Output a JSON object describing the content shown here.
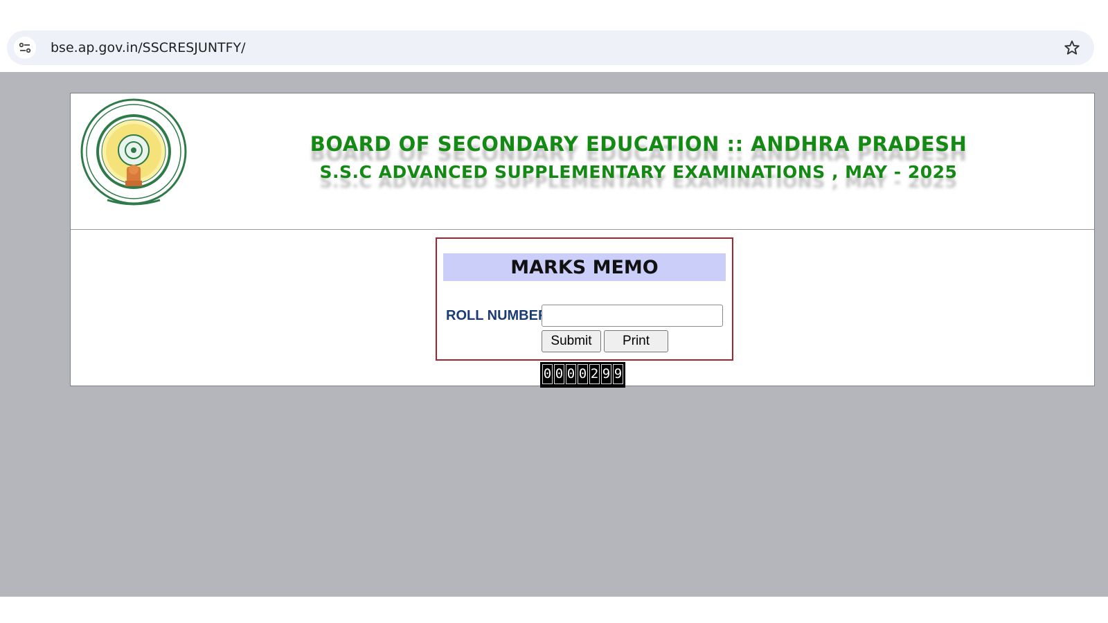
{
  "browser": {
    "url": "bse.ap.gov.in/SSCRESJUNTFY/",
    "site_icon": "tune-icon",
    "bookmark_icon": "star-icon"
  },
  "header": {
    "emblem": "andhra-pradesh-emblem",
    "title": "BOARD OF SECONDARY EDUCATION :: ANDHRA PRADESH",
    "subtitle": "S.S.C ADVANCED SUPPLEMENTARY EXAMINATIONS , MAY - 2025"
  },
  "form": {
    "heading": "MARKS MEMO",
    "roll_label": "ROLL NUMBER",
    "roll_value": "",
    "submit_label": "Submit",
    "print_label": "Print"
  },
  "counter": {
    "digits": [
      "0",
      "0",
      "0",
      "0",
      "2",
      "9",
      "9"
    ]
  },
  "colors": {
    "title_green": "#148a14",
    "memo_bar": "#cccefa",
    "form_border": "#a3242b",
    "label_blue": "#1a3b73",
    "page_background": "#b5b6bb"
  }
}
